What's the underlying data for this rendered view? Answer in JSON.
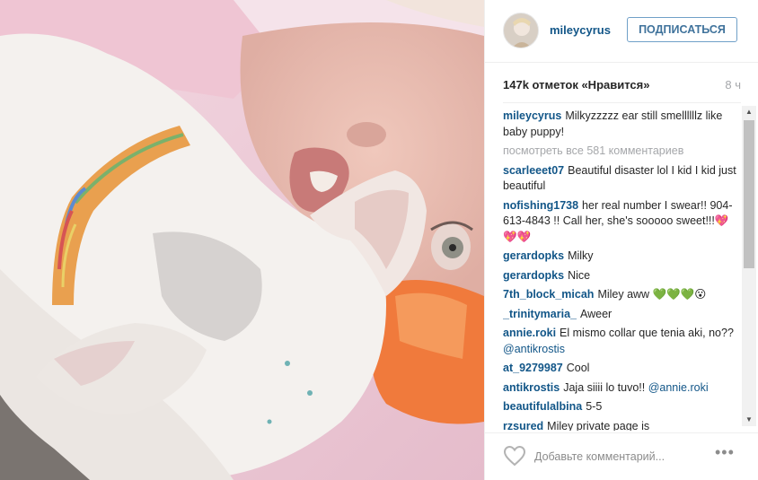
{
  "post": {
    "username": "mileycyrus",
    "follow_label": "ПОДПИСАТЬСЯ",
    "likes": "147k отметок «Нравится»",
    "time": "8 ч",
    "view_all": "посмотреть все 581 комментариев",
    "comments": [
      {
        "user": "mileycyrus",
        "text": "Milkyzzzzz ear still smellllllz like baby puppy!"
      },
      {
        "user": "scarleeet07",
        "text": "Beautiful disaster lol I kid I kid just beautiful"
      },
      {
        "user": "nofishing1738",
        "text": "her real number I swear!! 904-613-4843 !! Call her, she's sooooo sweet!!!💖💖💖"
      },
      {
        "user": "gerardopks",
        "text": "Milky"
      },
      {
        "user": "gerardopks",
        "text": "Nice"
      },
      {
        "user": "7th_block_micah",
        "text": "Miley aww 💚💚💚😮"
      },
      {
        "user": "_trinitymaria_",
        "text": "Aweer"
      },
      {
        "user": "annie.roki",
        "text": "El mismo collar que tenia aki, no??",
        "mention": "@antikrostis"
      },
      {
        "user": "at_9279987",
        "text": "Cool"
      },
      {
        "user": "antikrostis",
        "text": "Jaja siiii lo tuvo!! ",
        "mention": "@annie.roki"
      },
      {
        "user": "beautifulalbina",
        "text": "5-5"
      },
      {
        "user": "rzsured",
        "text": "Miley private page is"
      }
    ],
    "add_comment_placeholder": "Добавьте комментарий...",
    "more_label": "•••"
  },
  "icons": {
    "heart": "heart-outline-icon",
    "more": "more-options-icon",
    "scroll_up": "▲",
    "scroll_down": "▼"
  },
  "colors": {
    "username": "#125688",
    "follow_border": "#70a0c8",
    "follow_text": "#3f729b",
    "muted": "#a5a7aa"
  }
}
